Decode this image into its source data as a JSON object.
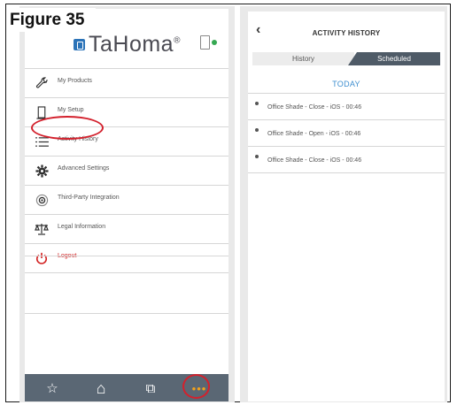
{
  "figure_label": "Figure 35",
  "left_screen": {
    "brand": "TaHoma",
    "brand_mark": "®",
    "menu": [
      {
        "icon": "wrench-icon",
        "label": "My Products"
      },
      {
        "icon": "box-icon",
        "label": "My Setup"
      },
      {
        "icon": "list-icon",
        "label": "Activity History"
      },
      {
        "icon": "gear-icon",
        "label": "Advanced Settings"
      },
      {
        "icon": "integration-icon",
        "label": "Third-Party Integration"
      },
      {
        "icon": "scales-icon",
        "label": "Legal Information"
      },
      {
        "icon": "power-icon",
        "label": "Logout"
      }
    ],
    "tabbar": {
      "favorites": "☆",
      "home": "⌂",
      "scenarios": "⧉",
      "more": "•••"
    }
  },
  "right_screen": {
    "back_glyph": "‹",
    "title": "ACTIVITY HISTORY",
    "tabs": {
      "history": "History",
      "scheduled": "Scheduled"
    },
    "section": "TODAY",
    "entries": [
      "Office Shade - Close - iOS - 00:46",
      "Office Shade - Open - iOS - 00:46",
      "Office Shade - Close - iOS - 00:46"
    ]
  },
  "colors": {
    "accent_blue": "#3f8fd0",
    "tabbar": "#5a6774",
    "highlight_red": "#d3212d",
    "logout_red": "#d21f1f",
    "more_dots": "#f2a21b"
  }
}
